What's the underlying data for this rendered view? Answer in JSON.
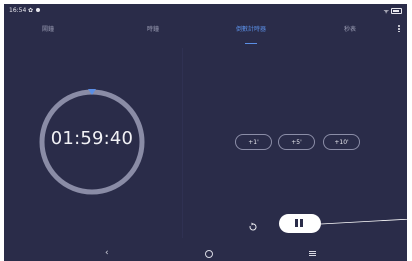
{
  "status_bar": {
    "time": "16:54",
    "left_icons": [
      "gear-icon",
      "notification-dot-icon"
    ],
    "right_icons": [
      "wifi-icon",
      "battery-icon"
    ]
  },
  "tabs": [
    {
      "label": "鬧鐘",
      "active": false
    },
    {
      "label": "時鐘",
      "active": false
    },
    {
      "label": "倒數計時器",
      "active": true
    },
    {
      "label": "秒表",
      "active": false
    }
  ],
  "timer": {
    "display": "01:59:40",
    "progress": 0.994
  },
  "add_buttons": [
    "+1'",
    "+5'",
    "+10'"
  ],
  "controls": {
    "reset_icon": "reset-icon",
    "pause_icon": "pause-icon"
  },
  "nav": {
    "back_icon": "back-icon",
    "home_icon": "home-icon",
    "recents_icon": "recents-icon"
  },
  "colors": {
    "background": "#2a2c49",
    "accent": "#5b8fe6",
    "ring": "#8a8ca6"
  }
}
